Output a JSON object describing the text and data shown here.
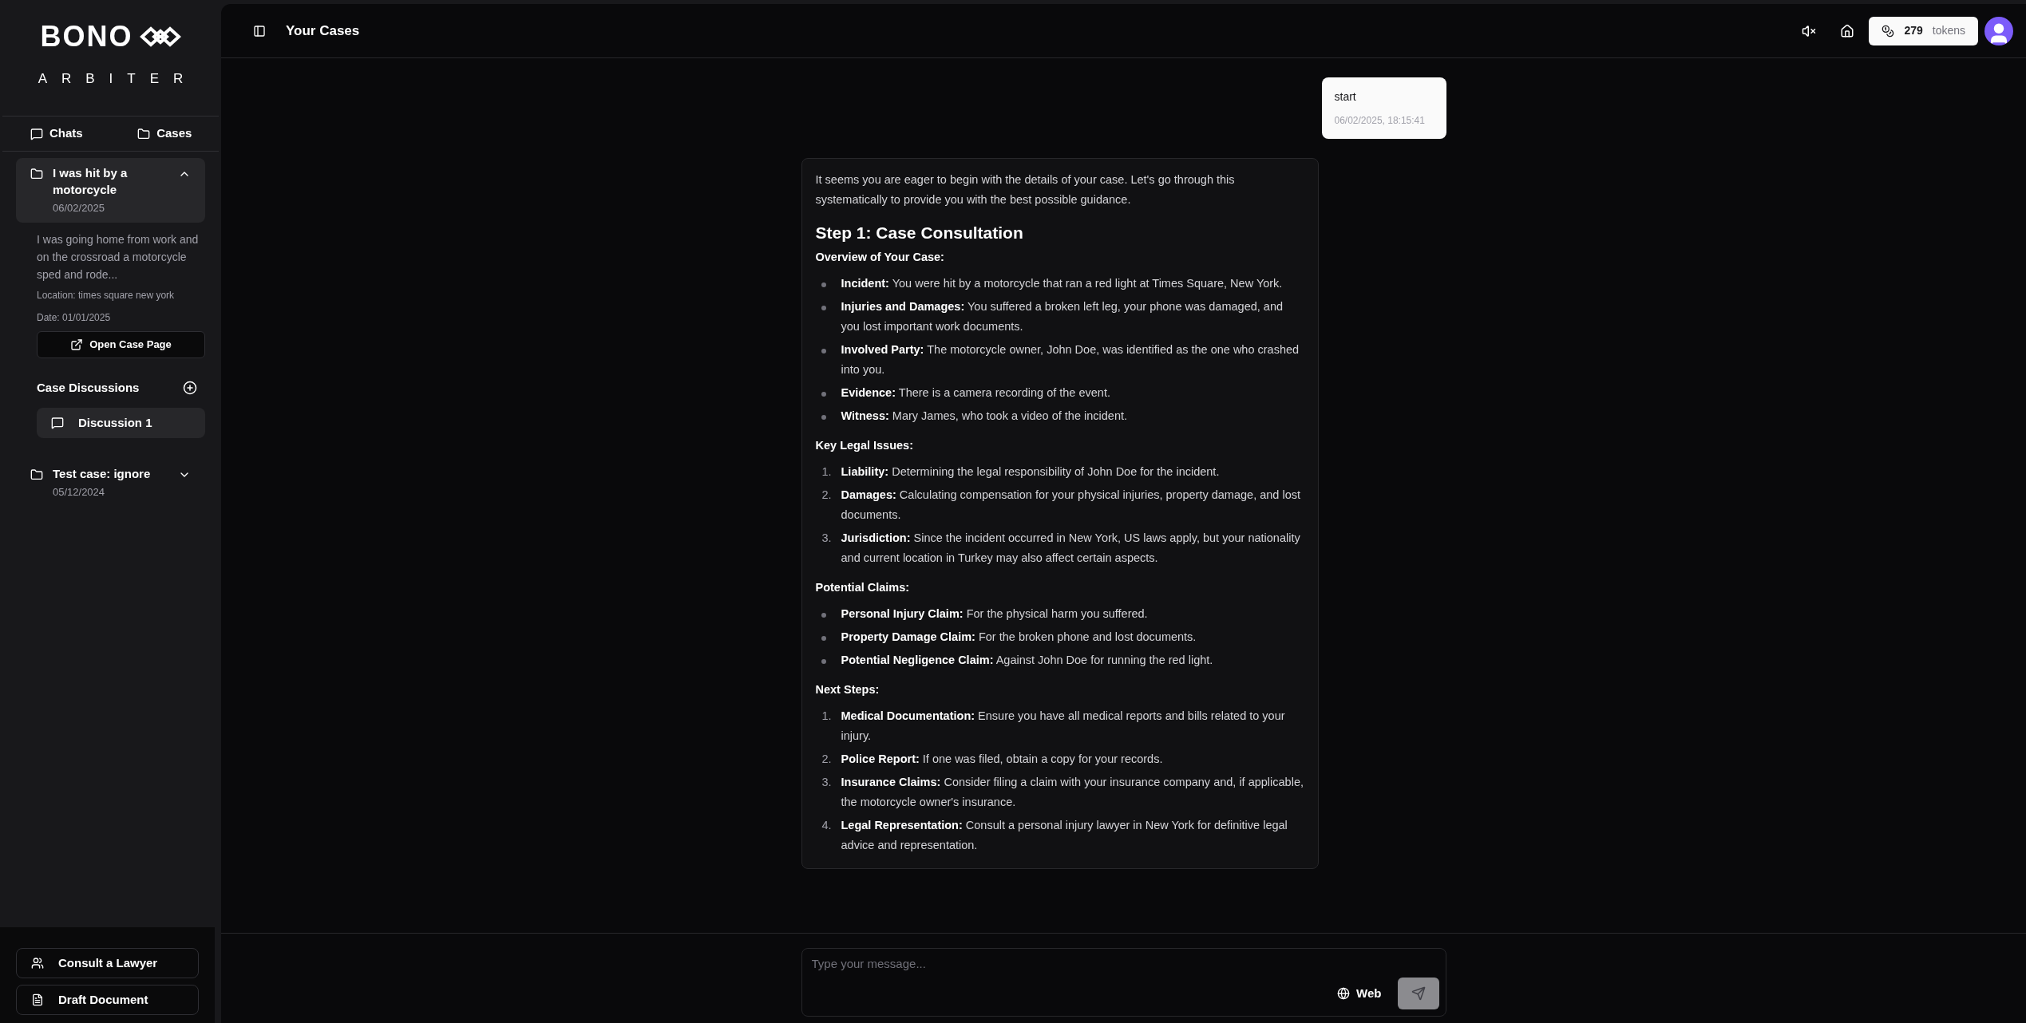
{
  "sidebar": {
    "logo": {
      "brand": "BONO",
      "subtitle": "ARBITER"
    },
    "tabs": [
      {
        "label": "Chats",
        "kind": "chat"
      },
      {
        "label": "Cases",
        "kind": "folder"
      }
    ],
    "cases": [
      {
        "title": "I was hit by a motorcycle",
        "date": "06/02/2025",
        "expanded": true,
        "description": "I was going home from work and on the crossroad a motorcycle sped and rode...",
        "location": "Location: times square new york",
        "incident_date": "Date: 01/01/2025",
        "open_button": "Open Case Page",
        "discussions_title": "Case Discussions",
        "discussions": [
          {
            "label": "Discussion 1",
            "selected": true
          }
        ]
      },
      {
        "title": "Test case: ignore",
        "date": "05/12/2024",
        "expanded": false
      }
    ],
    "actions": [
      {
        "label": "Consult a Lawyer",
        "kind": "people"
      },
      {
        "label": "Draft Document",
        "kind": "document"
      }
    ]
  },
  "header": {
    "title": "Your Cases",
    "tokens_count": "279",
    "tokens_label": "tokens"
  },
  "messages": [
    {
      "kind": "user",
      "text": "start",
      "time": "06/02/2025, 18:15:41"
    },
    {
      "kind": "assistant",
      "blocks": [
        {
          "kind": "paragraph",
          "text": "It seems you are eager to begin with the details of your case. Let's go through this systematically to provide you with the best possible guidance."
        },
        {
          "kind": "heading",
          "text": "Step 1: Case Consultation"
        },
        {
          "kind": "subheading",
          "text": "Overview of Your Case:"
        },
        {
          "kind": "bullets",
          "items": [
            {
              "label": "Incident:",
              "text": "You were hit by a motorcycle that ran a red light at Times Square, New York."
            },
            {
              "label": "Injuries and Damages:",
              "text": "You suffered a broken left leg, your phone was damaged, and you lost important work documents."
            },
            {
              "label": "Involved Party:",
              "text": "The motorcycle owner, John Doe, was identified as the one who crashed into you."
            },
            {
              "label": "Evidence:",
              "text": "There is a camera recording of the event."
            },
            {
              "label": "Witness:",
              "text": "Mary James, who took a video of the incident."
            }
          ]
        },
        {
          "kind": "subheading",
          "text": "Key Legal Issues:"
        },
        {
          "kind": "numbered",
          "items": [
            {
              "number": "1.",
              "label": "Liability:",
              "text": "Determining the legal responsibility of John Doe for the incident."
            },
            {
              "number": "2.",
              "label": "Damages:",
              "text": "Calculating compensation for your physical injuries, property damage, and lost documents."
            },
            {
              "number": "3.",
              "label": "Jurisdiction:",
              "text": "Since the incident occurred in New York, US laws apply, but your nationality and current location in Turkey may also affect certain aspects."
            }
          ]
        },
        {
          "kind": "subheading",
          "text": "Potential Claims:"
        },
        {
          "kind": "bullets",
          "items": [
            {
              "label": "Personal Injury Claim:",
              "text": "For the physical harm you suffered."
            },
            {
              "label": "Property Damage Claim:",
              "text": "For the broken phone and lost documents."
            },
            {
              "label": "Potential Negligence Claim:",
              "text": "Against John Doe for running the red light."
            }
          ]
        },
        {
          "kind": "subheading",
          "text": "Next Steps:"
        },
        {
          "kind": "numbered",
          "items": [
            {
              "number": "1.",
              "label": "Medical Documentation:",
              "text": "Ensure you have all medical reports and bills related to your injury."
            },
            {
              "number": "2.",
              "label": "Police Report:",
              "text": "If one was filed, obtain a copy for your records."
            },
            {
              "number": "3.",
              "label": "Insurance Claims:",
              "text": "Consider filing a claim with your insurance company and, if applicable, the motorcycle owner's insurance."
            },
            {
              "number": "4.",
              "label": "Legal Representation:",
              "text": "Consult a personal injury lawyer in New York for definitive legal advice and representation."
            }
          ]
        }
      ]
    }
  ],
  "composer": {
    "placeholder": "Type your message...",
    "web_label": "Web",
    "send_disabled": true
  }
}
